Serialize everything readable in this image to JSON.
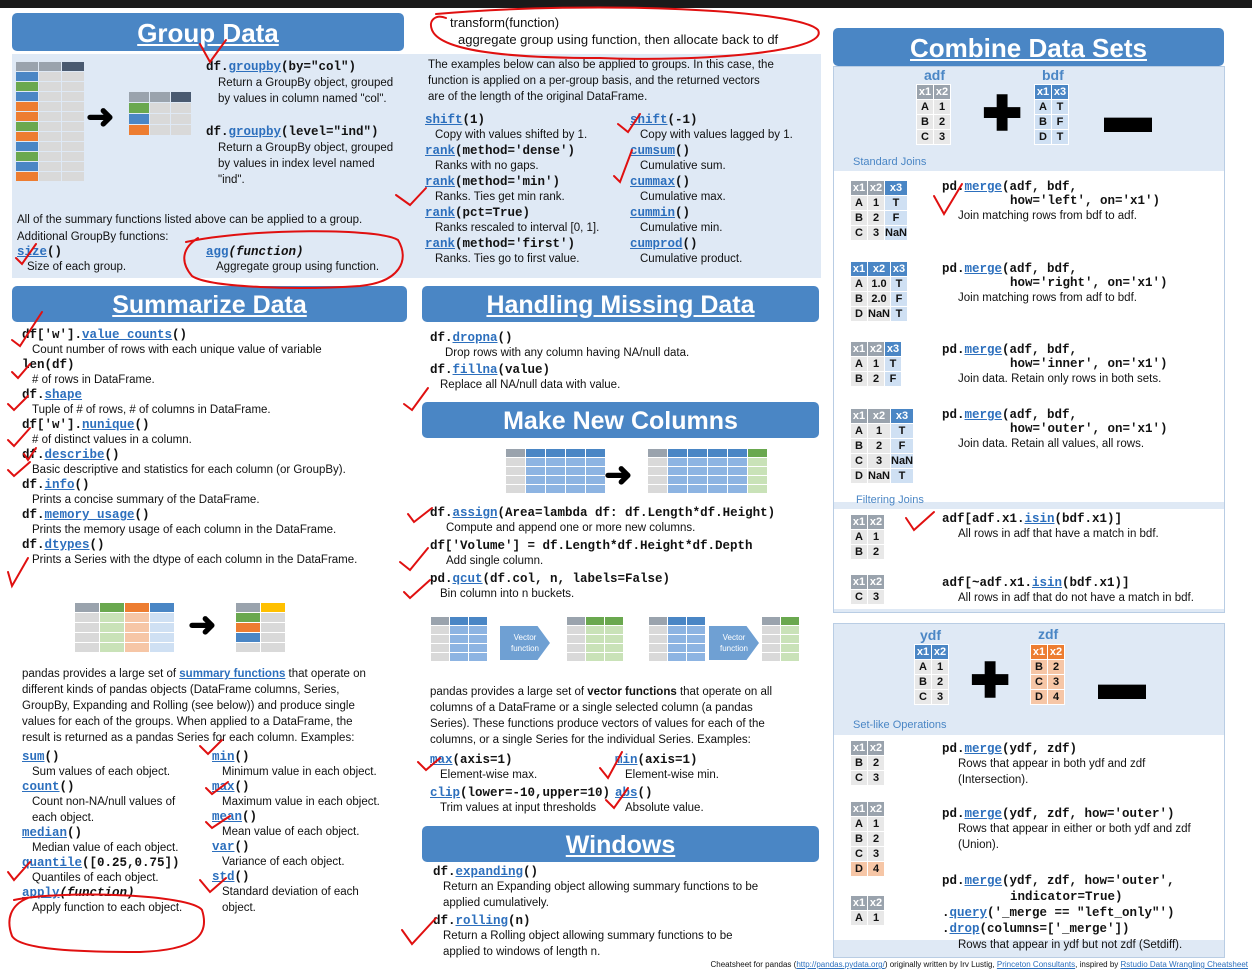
{
  "annotation_note": {
    "line1": "transform(function)",
    "line2": "aggregate group using function, then allocate back to df"
  },
  "headers": {
    "group": "Group Data",
    "summarize": "Summarize Data",
    "missing": "Handling Missing Data",
    "newcols": "Make New Columns",
    "windows": "Windows",
    "combine": "Combine Data Sets"
  },
  "group": {
    "groupby1_pre": "df.",
    "groupby1_fn": "groupby",
    "groupby1_post": "(by=\"col\")",
    "groupby1_desc1": "Return a GroupBy object, grouped",
    "groupby1_desc2": "by values in column named \"col\".",
    "groupby2_pre": "df.",
    "groupby2_fn": "groupby",
    "groupby2_post": "(level=\"ind\")",
    "groupby2_desc1": "Return a GroupBy object, grouped",
    "groupby2_desc2": "by values in index level named",
    "groupby2_desc3": "\"ind\".",
    "intro1": "The examples below can also be applied to groups. In this case, the",
    "intro2": "function is applied on a per-group basis, and the returned vectors",
    "intro3": "are of the length of the original DataFrame.",
    "summary_line1": "All of the summary functions listed above can be applied to a group.",
    "summary_line2": "Additional GroupBy functions:",
    "size_fn": "size",
    "size_post": "()",
    "size_desc": "Size of each group.",
    "agg_fn": "agg",
    "agg_arg": "(function)",
    "agg_desc": "Aggregate group using function.",
    "left_items": [
      {
        "fn": "shift",
        "post": "(1)",
        "desc": "Copy with values shifted by 1."
      },
      {
        "fn": "rank",
        "post": "(method='dense')",
        "desc": "Ranks with no gaps."
      },
      {
        "fn": "rank",
        "post": "(method='min')",
        "desc": "Ranks. Ties get min rank."
      },
      {
        "fn": "rank",
        "post": "(pct=True)",
        "desc": "Ranks rescaled to interval [0, 1]."
      },
      {
        "fn": "rank",
        "post": "(method='first')",
        "desc": "Ranks. Ties go to first value."
      }
    ],
    "right_items": [
      {
        "fn": "shift",
        "post": "(-1)",
        "desc": "Copy with values lagged by 1."
      },
      {
        "fn": "cumsum",
        "post": "()",
        "desc": "Cumulative sum."
      },
      {
        "fn": "cummax",
        "post": "()",
        "desc": "Cumulative max."
      },
      {
        "fn": "cummin",
        "post": "()",
        "desc": "Cumulative min."
      },
      {
        "fn": "cumprod",
        "post": "()",
        "desc": "Cumulative product."
      }
    ]
  },
  "summarize": {
    "items": [
      {
        "pre": "df['w'].",
        "fn": "value_counts",
        "post": "()",
        "desc": "Count number of rows with each unique value of variable"
      },
      {
        "pre": "len(df)",
        "fn": "",
        "post": "",
        "desc": "# of rows in DataFrame."
      },
      {
        "pre": "df.",
        "fn": "shape",
        "post": "",
        "desc": "Tuple of # of rows, # of columns in DataFrame."
      },
      {
        "pre": "df['w'].",
        "fn": "nunique",
        "post": "()",
        "desc": "# of distinct values in a column."
      },
      {
        "pre": "df.",
        "fn": "describe",
        "post": "()",
        "desc": "Basic descriptive and statistics for each column (or GroupBy)."
      },
      {
        "pre": "df.",
        "fn": "info",
        "post": "()",
        "desc": "Prints a concise summary of the DataFrame."
      },
      {
        "pre": "df.",
        "fn": "memory_usage",
        "post": "()",
        "desc": "Prints the memory usage of each column in the DataFrame."
      },
      {
        "pre": "df.",
        "fn": "dtypes",
        "post": "()",
        "desc": "Prints a Series with the dtype of each column in the DataFrame."
      }
    ],
    "para_pre": "pandas provides a large set of ",
    "para_link": "summary functions",
    "para_post": " that operate on",
    "para2": "different kinds of pandas objects (DataFrame columns, Series,",
    "para3": "GroupBy, Expanding and Rolling (see below)) and produce single",
    "para4": "values for each of the groups. When applied to a DataFrame, the",
    "para5": "result is returned as a pandas Series for each column. Examples:",
    "left_funcs": [
      {
        "fn": "sum",
        "post": "()",
        "desc": "Sum values of each object."
      },
      {
        "fn": "count",
        "post": "()",
        "desc": "Count non-NA/null values of",
        "desc2": "each object."
      },
      {
        "fn": "median",
        "post": "()",
        "desc": "Median value of each object."
      },
      {
        "fn": "quantile",
        "post": "([0.25,0.75])",
        "desc": "Quantiles of each object."
      },
      {
        "fn": "apply",
        "post": "(function)",
        "desc": "Apply function to each object."
      }
    ],
    "right_funcs": [
      {
        "fn": "min",
        "post": "()",
        "desc": "Minimum value in each object."
      },
      {
        "fn": "max",
        "post": "()",
        "desc": "Maximum value in each object."
      },
      {
        "fn": "mean",
        "post": "()",
        "desc": "Mean value of each object."
      },
      {
        "fn": "var",
        "post": "()",
        "desc": "Variance of each object."
      },
      {
        "fn": "std",
        "post": "()",
        "desc": "Standard deviation of each",
        "desc2": "object."
      }
    ]
  },
  "missing": {
    "dropna_pre": "df.",
    "dropna_fn": "dropna",
    "dropna_post": "()",
    "dropna_desc": "Drop rows with any column having NA/null data.",
    "fillna_pre": "df.",
    "fillna_fn": "fillna",
    "fillna_post": "(value)",
    "fillna_desc": "Replace all NA/null data with value."
  },
  "newcols": {
    "assign_pre": "df.",
    "assign_fn": "assign",
    "assign_post": "(Area=lambda df: df.Length*df.Height)",
    "assign_desc": "Compute and append one or more new columns.",
    "vol_code": "df['Volume'] = df.Length*df.Height*df.Depth",
    "vol_desc": "Add single column.",
    "qcut_pre": "pd.",
    "qcut_fn": "qcut",
    "qcut_post": "(df.col, n, labels=False)",
    "qcut_desc": "Bin column into n buckets.",
    "vector_label": "Vector function",
    "para1_pre": "pandas provides a large set of ",
    "para1_bold": "vector functions",
    "para1_post": " that operate on all",
    "para2": "columns of a DataFrame or a single selected column (a pandas",
    "para3": "Series). These functions produce vectors of values for each of the",
    "para4": "columns, or a single Series for the individual Series. Examples:",
    "funcs": [
      {
        "fn": "max",
        "post": "(axis=1)",
        "desc": "Element-wise max."
      },
      {
        "fn": "min",
        "post": "(axis=1)",
        "desc": "Element-wise min."
      },
      {
        "fn": "clip",
        "post": "(lower=-10,upper=10)",
        "desc": "Trim values at input thresholds"
      },
      {
        "fn": "abs",
        "post": "()",
        "desc": "Absolute value."
      }
    ]
  },
  "windows": {
    "exp_pre": "df.",
    "exp_fn": "expanding",
    "exp_post": "()",
    "exp_desc1": "Return an Expanding object allowing summary functions to be",
    "exp_desc2": "applied cumulatively.",
    "roll_pre": "df.",
    "roll_fn": "rolling",
    "roll_post": "(n)",
    "roll_desc1": "Return a Rolling object allowing summary functions to be",
    "roll_desc2": "applied to windows of length n."
  },
  "combine": {
    "adf_label": "adf",
    "bdf_label": "bdf",
    "standard_joins": "Standard Joins",
    "filtering_joins": "Filtering Joins",
    "setlike": "Set-like Operations",
    "ydf_label": "ydf",
    "zdf_label": "zdf",
    "joins": [
      {
        "pre": "pd.",
        "fn": "merge",
        "l1": "(adf, bdf,",
        "l2": "how='left', on='x1')",
        "desc": "Join matching rows from bdf to adf."
      },
      {
        "pre": "pd.",
        "fn": "merge",
        "l1": "(adf, bdf,",
        "l2": "how='right', on='x1')",
        "desc": "Join matching rows from adf to bdf."
      },
      {
        "pre": "pd.",
        "fn": "merge",
        "l1": "(adf, bdf,",
        "l2": "how='inner', on='x1')",
        "desc": "Join data. Retain only rows in both sets."
      },
      {
        "pre": "pd.",
        "fn": "merge",
        "l1": "(adf, bdf,",
        "l2": "how='outer', on='x1')",
        "desc": "Join data. Retain all values, all rows."
      }
    ],
    "filter1_pre": "adf[adf.x1.",
    "filter1_fn": "isin",
    "filter1_post": "(bdf.x1)]",
    "filter1_desc": "All rows in adf that have a match in bdf.",
    "filter2_pre": "adf[~adf.x1.",
    "filter2_fn": "isin",
    "filter2_post": "(bdf.x1)]",
    "filter2_desc": "All rows in adf that do not have a match in bdf.",
    "set1_pre": "pd.",
    "set1_fn": "merge",
    "set1_post": "(ydf, zdf)",
    "set1_desc1": "Rows that appear in both ydf and zdf",
    "set1_desc2": "(Intersection).",
    "set2_pre": "pd.",
    "set2_fn": "merge",
    "set2_post": "(ydf, zdf, how='outer')",
    "set2_desc1": "Rows that appear in either or both ydf and zdf",
    "set2_desc2": "(Union).",
    "set3_pre": "pd.",
    "set3_fn": "merge",
    "set3_post": "(ydf, zdf, how='outer',",
    "set3_l2": "indicator=True)",
    "set3_l3_pre": ".",
    "set3_l3_fn": "query",
    "set3_l3_post": "('_merge == \"left_only\"')",
    "set3_l4_pre": ".",
    "set3_l4_fn": "drop",
    "set3_l4_post": "(columns=['_merge'])",
    "set3_desc": "Rows that appear in ydf but not zdf (Setdiff)."
  },
  "tables": {
    "adf": [
      [
        "x1",
        "x2"
      ],
      [
        "A",
        "1"
      ],
      [
        "B",
        "2"
      ],
      [
        "C",
        "3"
      ]
    ],
    "bdf": [
      [
        "x1",
        "x3"
      ],
      [
        "A",
        "T"
      ],
      [
        "B",
        "F"
      ],
      [
        "D",
        "T"
      ]
    ],
    "left": [
      [
        "x1",
        "x2",
        "x3"
      ],
      [
        "A",
        "1",
        "T"
      ],
      [
        "B",
        "2",
        "F"
      ],
      [
        "C",
        "3",
        "NaN"
      ]
    ],
    "right": [
      [
        "x1",
        "x2",
        "x3"
      ],
      [
        "A",
        "1.0",
        "T"
      ],
      [
        "B",
        "2.0",
        "F"
      ],
      [
        "D",
        "NaN",
        "T"
      ]
    ],
    "inner": [
      [
        "x1",
        "x2",
        "x3"
      ],
      [
        "A",
        "1",
        "T"
      ],
      [
        "B",
        "2",
        "F"
      ]
    ],
    "outer": [
      [
        "x1",
        "x2",
        "x3"
      ],
      [
        "A",
        "1",
        "T"
      ],
      [
        "B",
        "2",
        "F"
      ],
      [
        "C",
        "3",
        "NaN"
      ],
      [
        "D",
        "NaN",
        "T"
      ]
    ],
    "semi": [
      [
        "x1",
        "x2"
      ],
      [
        "A",
        "1"
      ],
      [
        "B",
        "2"
      ]
    ],
    "anti": [
      [
        "x1",
        "x2"
      ],
      [
        "C",
        "3"
      ]
    ],
    "ydf": [
      [
        "x1",
        "x2"
      ],
      [
        "A",
        "1"
      ],
      [
        "B",
        "2"
      ],
      [
        "C",
        "3"
      ]
    ],
    "zdf": [
      [
        "x1",
        "x2"
      ],
      [
        "B",
        "2"
      ],
      [
        "C",
        "3"
      ],
      [
        "D",
        "4"
      ]
    ],
    "inter": [
      [
        "x1",
        "x2"
      ],
      [
        "B",
        "2"
      ],
      [
        "C",
        "3"
      ]
    ],
    "union": [
      [
        "x1",
        "x2"
      ],
      [
        "A",
        "1"
      ],
      [
        "B",
        "2"
      ],
      [
        "C",
        "3"
      ],
      [
        "D",
        "4"
      ]
    ],
    "diff": [
      [
        "x1",
        "x2"
      ],
      [
        "A",
        "1"
      ]
    ]
  },
  "footer": {
    "pre": "Cheatsheet for pandas (",
    "link1": "http://pandas.pydata.org/",
    "mid": ") originally written by Irv Lustig, ",
    "link2": "Princeton Consultants",
    "mid2": ",  inspired by ",
    "link3": "Rstudio Data Wrangling Cheatsheet"
  }
}
